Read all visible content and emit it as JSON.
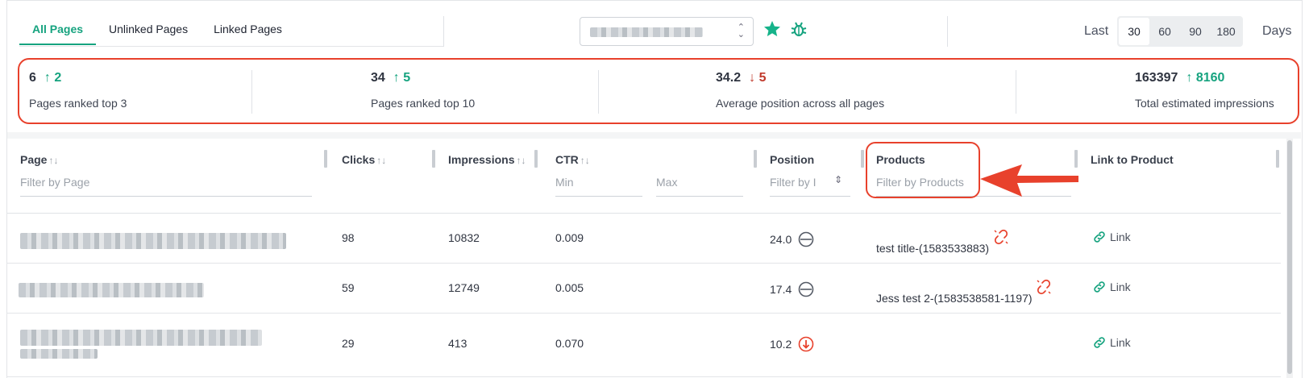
{
  "tabs": [
    {
      "label": "All Pages",
      "active": true
    },
    {
      "label": "Unlinked Pages",
      "active": false
    },
    {
      "label": "Linked Pages",
      "active": false
    }
  ],
  "site_select": {
    "icon": "chevron-up-down-icon"
  },
  "toolbar": {
    "star_icon": "star-icon",
    "bug_icon": "bug-icon"
  },
  "days": {
    "prefix": "Last",
    "options": [
      "30",
      "60",
      "90",
      "180"
    ],
    "selected": "30",
    "suffix": "Days"
  },
  "stats": [
    {
      "value": "6",
      "delta": "2",
      "direction": "up",
      "label": "Pages ranked top 3"
    },
    {
      "value": "34",
      "delta": "5",
      "direction": "up",
      "label": "Pages ranked top 10"
    },
    {
      "value": "34.2",
      "delta": "5",
      "direction": "down",
      "label": "Average position across all pages"
    },
    {
      "value": "163397",
      "delta": "8160",
      "direction": "up",
      "label": "Total estimated impressions"
    }
  ],
  "columns": {
    "page": {
      "label": "Page",
      "filter_placeholder": "Filter by Page"
    },
    "clicks": {
      "label": "Clicks"
    },
    "impressions": {
      "label": "Impressions"
    },
    "ctr": {
      "label": "CTR",
      "min_placeholder": "Min",
      "max_placeholder": "Max"
    },
    "position": {
      "label": "Position",
      "filter_placeholder": "Filter by I"
    },
    "products": {
      "label": "Products",
      "filter_placeholder": "Filter by Products"
    },
    "link": {
      "label": "Link to Product"
    }
  },
  "rows": [
    {
      "clicks": "98",
      "impressions": "10832",
      "ctr": "0.009",
      "position": "24.0",
      "position_status": "neutral",
      "product": "test title-(1583533883)",
      "product_icon": "broken-link-icon",
      "link_label": "Link"
    },
    {
      "clicks": "59",
      "impressions": "12749",
      "ctr": "0.005",
      "position": "17.4",
      "position_status": "neutral",
      "product": "Jess test 2-(1583538581-1197)",
      "product_icon": "broken-link-icon",
      "link_label": "Link"
    },
    {
      "clicks": "29",
      "impressions": "413",
      "ctr": "0.070",
      "position": "10.2",
      "position_status": "down",
      "product": "",
      "link_label": "Link"
    }
  ],
  "colors": {
    "accent": "#16a37f",
    "annotation": "#e8412c",
    "negative": "#e8412c"
  }
}
